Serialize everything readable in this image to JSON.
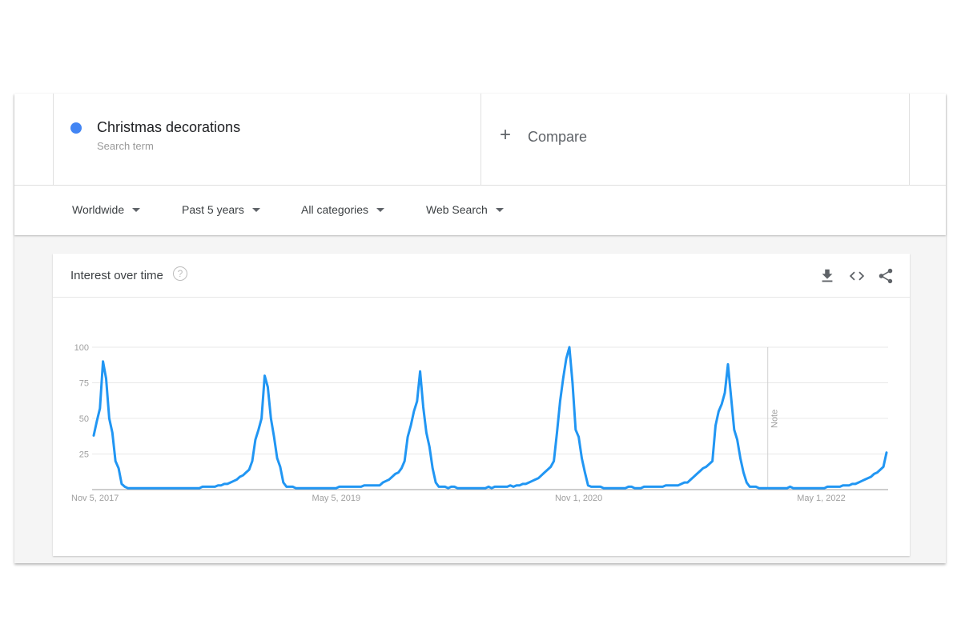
{
  "search_term": {
    "name": "Christmas decorations",
    "subtitle": "Search term",
    "color": "#4285f4"
  },
  "compare": {
    "label": "Compare",
    "icon": "plus-icon"
  },
  "filters": [
    {
      "label": "Worldwide"
    },
    {
      "label": "Past 5 years"
    },
    {
      "label": "All categories"
    },
    {
      "label": "Web Search"
    }
  ],
  "card": {
    "title": "Interest over time",
    "help_icon": "?",
    "actions": [
      "download-icon",
      "embed-icon",
      "share-icon"
    ]
  },
  "chart_data": {
    "type": "line",
    "title": "Interest over time",
    "xlabel": "",
    "ylabel": "",
    "ylim": [
      0,
      100
    ],
    "yticks": [
      25,
      50,
      75,
      100
    ],
    "xtick_labels": [
      "Nov 5, 2017",
      "May 5, 2019",
      "Nov 1, 2020",
      "May 1, 2022"
    ],
    "xtick_indices": [
      0,
      78,
      156,
      234
    ],
    "grid": true,
    "annotations": [
      {
        "text": "Note",
        "index": 215
      }
    ],
    "series": [
      {
        "name": "Christmas decorations",
        "color": "#2196f3",
        "values": [
          38,
          48,
          57,
          90,
          78,
          50,
          40,
          20,
          15,
          4,
          2,
          1,
          1,
          1,
          1,
          1,
          1,
          1,
          1,
          1,
          1,
          1,
          1,
          1,
          1,
          1,
          1,
          1,
          1,
          1,
          1,
          1,
          1,
          1,
          1,
          2,
          2,
          2,
          2,
          2,
          3,
          3,
          4,
          4,
          5,
          6,
          7,
          9,
          10,
          12,
          14,
          20,
          35,
          42,
          50,
          80,
          72,
          50,
          37,
          22,
          16,
          5,
          2,
          2,
          2,
          1,
          1,
          1,
          1,
          1,
          1,
          1,
          1,
          1,
          1,
          1,
          1,
          1,
          1,
          2,
          2,
          2,
          2,
          2,
          2,
          2,
          2,
          3,
          3,
          3,
          3,
          3,
          3,
          5,
          6,
          7,
          9,
          11,
          12,
          15,
          20,
          37,
          45,
          55,
          62,
          83,
          58,
          40,
          30,
          15,
          5,
          2,
          2,
          2,
          1,
          2,
          2,
          1,
          1,
          1,
          1,
          1,
          1,
          1,
          1,
          1,
          1,
          2,
          1,
          2,
          2,
          2,
          2,
          2,
          3,
          2,
          3,
          3,
          4,
          4,
          5,
          6,
          7,
          8,
          10,
          12,
          14,
          16,
          20,
          40,
          62,
          78,
          92,
          100,
          75,
          42,
          37,
          22,
          12,
          3,
          2,
          2,
          2,
          2,
          1,
          1,
          1,
          1,
          1,
          1,
          1,
          1,
          2,
          2,
          1,
          1,
          1,
          2,
          2,
          2,
          2,
          2,
          2,
          2,
          3,
          3,
          3,
          3,
          3,
          4,
          5,
          5,
          7,
          9,
          11,
          13,
          15,
          16,
          18,
          20,
          45,
          55,
          60,
          68,
          88,
          65,
          42,
          35,
          22,
          12,
          5,
          2,
          2,
          2,
          1,
          1,
          1,
          1,
          1,
          1,
          1,
          1,
          1,
          1,
          2,
          1,
          1,
          1,
          1,
          1,
          1,
          1,
          1,
          1,
          1,
          1,
          2,
          2,
          2,
          2,
          2,
          3,
          3,
          3,
          4,
          4,
          5,
          6,
          7,
          8,
          9,
          11,
          12,
          14,
          16,
          26
        ]
      }
    ]
  }
}
